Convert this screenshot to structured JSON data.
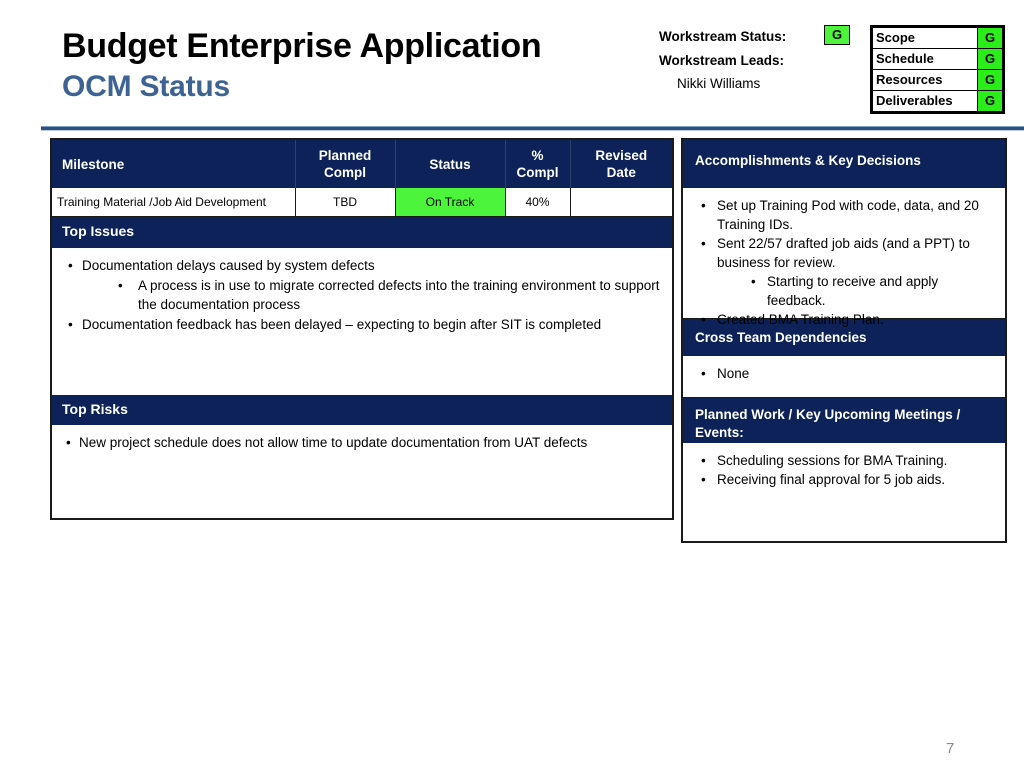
{
  "header": {
    "main_title": "Budget Enterprise Application",
    "sub_title": "OCM Status",
    "accent_color": "#3d6394"
  },
  "workstream": {
    "status_label": "Workstream Status:",
    "status_value": "G",
    "leads_label": "Workstream Leads:",
    "lead_name": "Nikki Williams",
    "status_color": "#4df43c",
    "indicators": [
      {
        "label": "Scope",
        "value": "G"
      },
      {
        "label": "Schedule",
        "value": "G"
      },
      {
        "label": "Resources",
        "value": "G"
      },
      {
        "label": "Deliverables",
        "value": "G"
      }
    ]
  },
  "milestone_table": {
    "columns": [
      "Milestone",
      "Planned Compl",
      "Status",
      "% Compl",
      "Revised Date"
    ],
    "column_lines": [
      [
        "Milestone"
      ],
      [
        "Planned",
        "Compl"
      ],
      [
        "Status"
      ],
      [
        "%",
        "Compl"
      ],
      [
        "Revised",
        "Date"
      ]
    ],
    "rows": [
      {
        "milestone": "Training Material /Job Aid Development",
        "planned_compl": "TBD",
        "status": "On Track",
        "pct_compl": "40%",
        "revised_date": "",
        "status_color": "#4df43c"
      }
    ]
  },
  "top_issues": {
    "title": "Top Issues",
    "items": [
      {
        "level": 1,
        "text": "Documentation delays caused by system defects"
      },
      {
        "level": 2,
        "text": "A process is in use to migrate corrected defects into the training environment to support the documentation process"
      },
      {
        "level": 1,
        "text": "Documentation feedback has been delayed – expecting to begin after SIT is completed"
      }
    ]
  },
  "top_risks": {
    "title": "Top Risks",
    "items": [
      {
        "level": 1,
        "text": "New project schedule does not allow time to update documentation from UAT defects"
      }
    ]
  },
  "accomplishments": {
    "title": "Accomplishments  & Key Decisions",
    "items": [
      {
        "level": 1,
        "text": "Set up Training Pod with code, data, and 20 Training IDs."
      },
      {
        "level": 1,
        "text": "Sent 22/57 drafted job aids (and a PPT) to business for review."
      },
      {
        "level": 2,
        "text": "Starting to receive and apply feedback."
      },
      {
        "level": 1,
        "text": "Created BMA Training Plan."
      }
    ]
  },
  "cross_team_dependencies": {
    "title": "Cross Team Dependencies",
    "items": [
      {
        "level": 1,
        "text": "None"
      }
    ]
  },
  "planned_work": {
    "title": "Planned Work / Key  Upcoming Meetings / Events:",
    "items": [
      {
        "level": 1,
        "text": "Scheduling sessions for BMA Training."
      },
      {
        "level": 1,
        "text": "Receiving final approval for 5 job aids."
      }
    ]
  },
  "footer": {
    "page_number": "7"
  }
}
